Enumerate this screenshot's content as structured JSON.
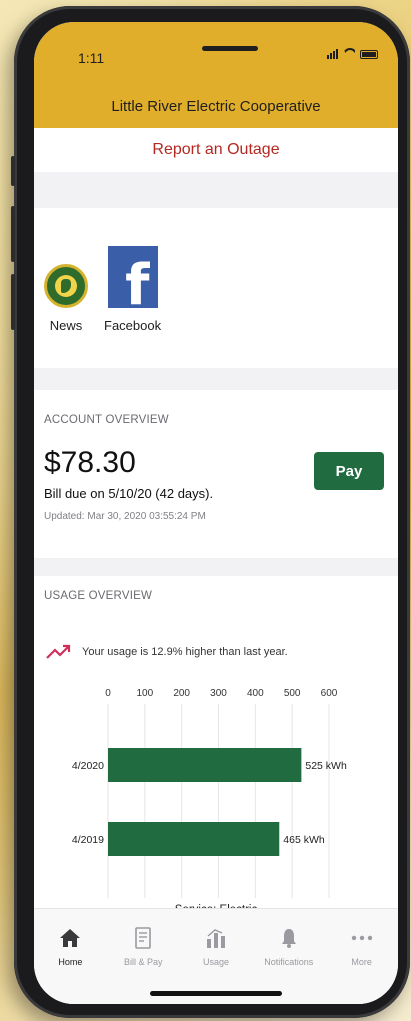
{
  "status": {
    "time": "1:11"
  },
  "header": {
    "title": "Little River Electric Cooperative"
  },
  "outage": {
    "label": "Report an Outage"
  },
  "social": {
    "news": "News",
    "facebook": "Facebook",
    "news_logo_text": "LITTLE RIVER ELECTRIC COOPERATIVE INC"
  },
  "account": {
    "section_title": "ACCOUNT OVERVIEW",
    "balance": "$78.30",
    "pay_label": "Pay",
    "due": "Bill due on 5/10/20 (42 days).",
    "updated": "Updated: Mar 30, 2020 03:55:24 PM"
  },
  "usage": {
    "section_title": "USAGE OVERVIEW",
    "note": "Your usage is 12.9% higher than last year.",
    "service": "Service: Electric"
  },
  "chart_data": {
    "type": "bar",
    "orientation": "horizontal",
    "categories": [
      "4/2020",
      "4/2019"
    ],
    "values": [
      525,
      465
    ],
    "value_labels": [
      "525 kWh",
      "465 kWh"
    ],
    "ticks": [
      "0",
      "100",
      "200",
      "300",
      "400",
      "500",
      "600"
    ],
    "xlim": [
      0,
      600
    ],
    "grid": true,
    "bar_color": "#206c40"
  },
  "tabs": [
    {
      "label": "Home",
      "icon": "home-icon",
      "active": true
    },
    {
      "label": "Bill & Pay",
      "icon": "bill-icon",
      "active": false
    },
    {
      "label": "Usage",
      "icon": "usage-icon",
      "active": false
    },
    {
      "label": "Notifications",
      "icon": "bell-icon",
      "active": false
    },
    {
      "label": "More",
      "icon": "more-icon",
      "active": false
    }
  ],
  "colors": {
    "header": "#e1ae2b",
    "accent_red": "#b52822",
    "button_green": "#206c40",
    "trend_red": "#d22d5a"
  }
}
